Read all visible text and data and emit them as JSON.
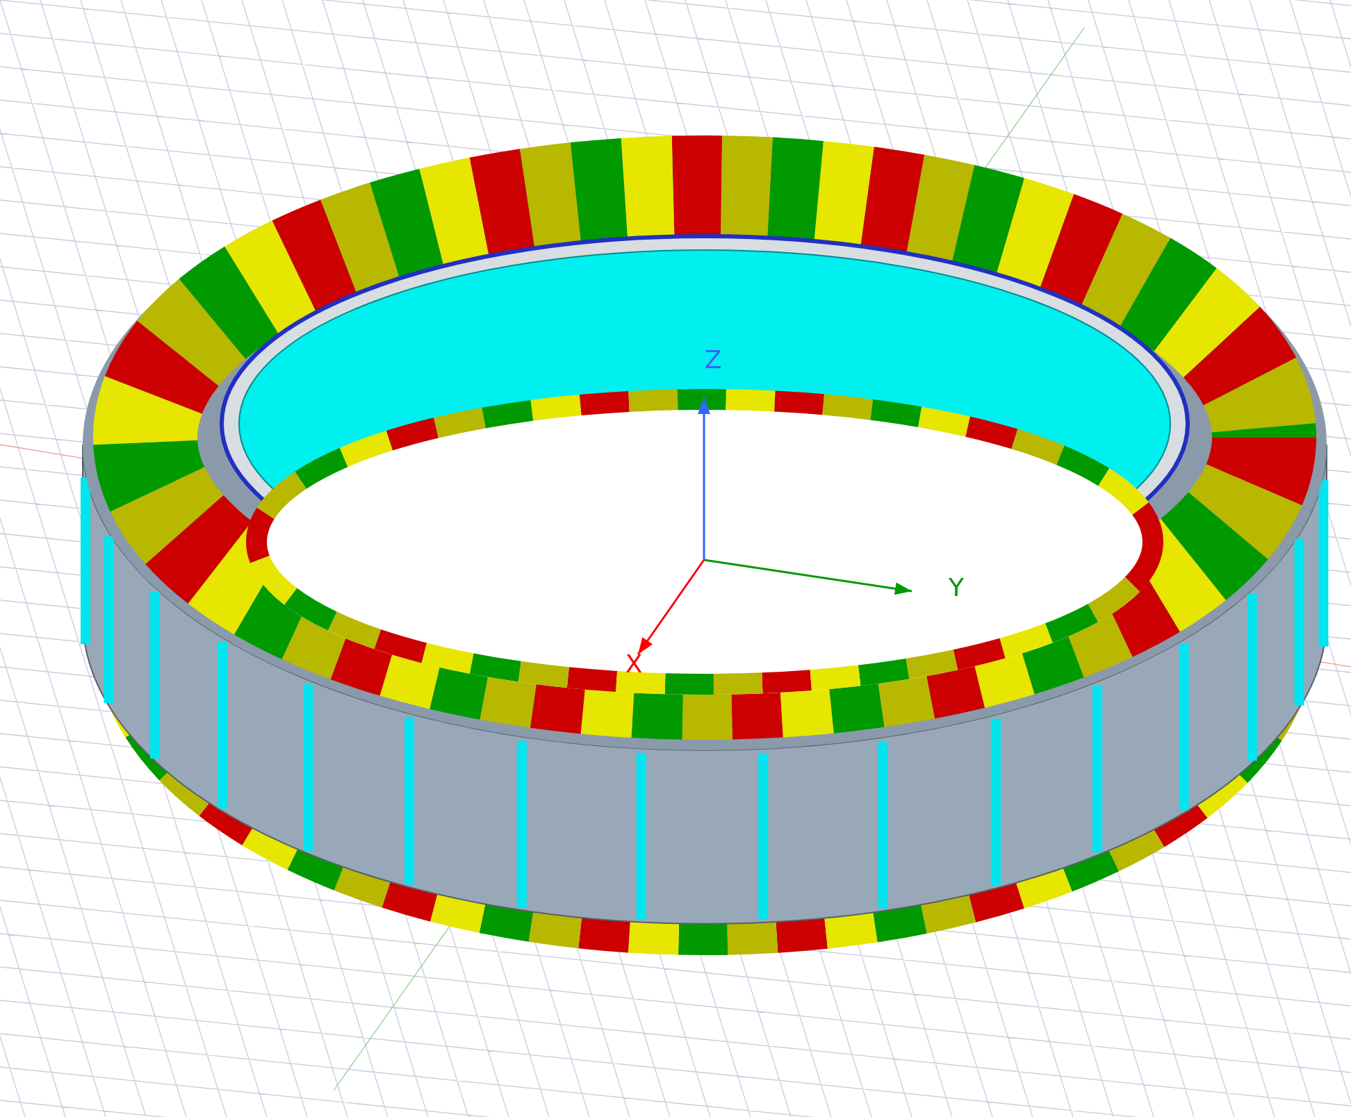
{
  "viewport": {
    "axes": [
      {
        "label": "Z",
        "color": "#3366ff"
      },
      {
        "label": "Y",
        "color": "#009900"
      },
      {
        "label": "X",
        "color": "#ff0000"
      }
    ]
  }
}
